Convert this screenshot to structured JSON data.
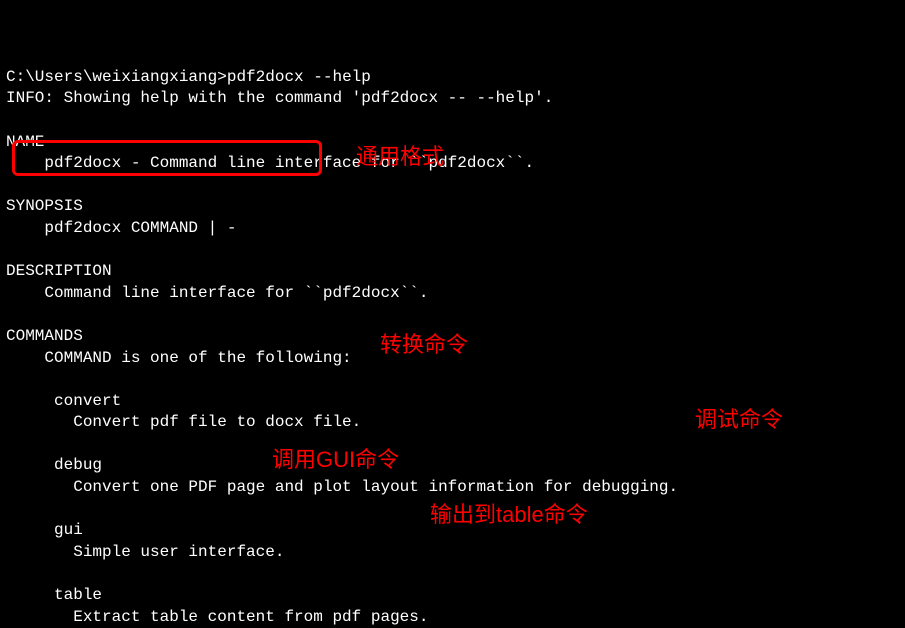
{
  "prompt": "C:\\Users\\weixiangxiang>",
  "cmd": "pdf2docx --help",
  "info": "INFO: Showing help with the command 'pdf2docx -- --help'.",
  "name_hdr": "NAME",
  "name_line": "    pdf2docx - Command line interface for ``pdf2docx``.",
  "syn_hdr": "SYNOPSIS",
  "syn_line": "    pdf2docx COMMAND | -",
  "desc_hdr": "DESCRIPTION",
  "desc_line": "    Command line interface for ``pdf2docx``.",
  "cmds_hdr": "COMMANDS",
  "cmds_intro": "    COMMAND is one of the following:",
  "cmd_convert": "     convert",
  "cmd_convert_desc": "       Convert pdf file to docx file.",
  "cmd_debug": "     debug",
  "cmd_debug_desc": "       Convert one PDF page and plot layout information for debugging.",
  "cmd_gui": "     gui",
  "cmd_gui_desc": "       Simple user interface.",
  "cmd_table": "     table",
  "cmd_table_desc": "       Extract table content from pdf pages.",
  "labels": {
    "general_format": "通用格式",
    "convert_cmd": "转换命令",
    "debug_cmd": "调试命令",
    "gui_cmd": "调用GUI命令",
    "table_cmd": "输出到table命令"
  }
}
